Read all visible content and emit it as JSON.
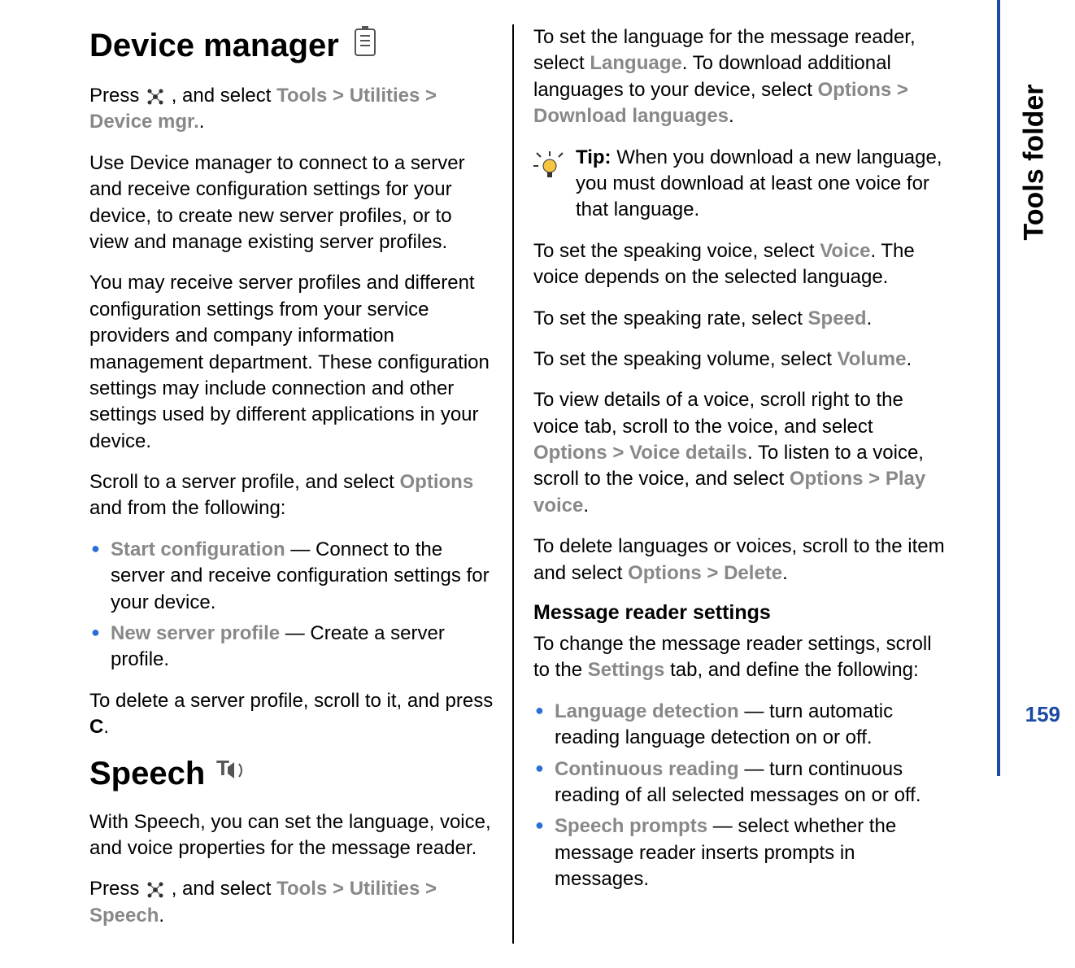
{
  "side_tab": "Tools folder",
  "page_number": "159",
  "left": {
    "h1_device_mgr": "Device manager",
    "dm_press_1": "Press ",
    "dm_press_2": " , and select ",
    "dm_nav_tools": "Tools",
    "dm_nav_util": "Utilities",
    "dm_nav_target": "Device mgr.",
    "dm_period": ".",
    "dm_p1": "Use Device manager to connect to a server and receive configuration settings for your device, to create new server profiles, or to view and manage existing server profiles.",
    "dm_p2": "You may receive server profiles and different configuration settings from your service providers and company information management department. These configuration settings may include connection and other settings used by different applications in your device.",
    "dm_p3a": "Scroll to a server profile, and select ",
    "dm_p3_options": "Options",
    "dm_p3b": " and from the following:",
    "dm_li1_term": "Start configuration",
    "dm_li1_rest": "  — Connect to the server and receive configuration settings for your device.",
    "dm_li2_term": "New server profile",
    "dm_li2_rest": "  — Create a server profile.",
    "dm_p4a": "To delete a server profile, scroll to it, and press ",
    "dm_p4_c": "C",
    "dm_p4b": ".",
    "h1_speech": "Speech",
    "sp_p1": "With Speech, you can set the language, voice, and voice properties for the message reader.",
    "sp_press_1": "Press ",
    "sp_press_2": " , and select ",
    "sp_nav_tools": "Tools",
    "sp_nav_util": "Utilities",
    "sp_nav_target": "Speech",
    "sp_period": "."
  },
  "right": {
    "p1a": "To set the language for the message reader, select ",
    "p1_lang": "Language",
    "p1b": ". To download additional languages to your device, select ",
    "p1_opt": "Options",
    "p1_dl": "Download languages",
    "p1c": ".",
    "tip_label": "Tip:",
    "tip_text": " When you download a new language, you must download at least one voice for that language.",
    "p2a": "To set the speaking voice, select ",
    "p2_voice": "Voice",
    "p2b": ". The voice depends on the selected language.",
    "p3a": "To set the speaking rate, select ",
    "p3_speed": "Speed",
    "p3b": ".",
    "p4a": "To set the speaking volume, select ",
    "p4_vol": "Volume",
    "p4b": ".",
    "p5a": "To view details of a voice, scroll right to the voice tab, scroll to the voice, and select ",
    "p5_opt1": "Options",
    "p5_vd": "Voice details",
    "p5b": ". To listen to a voice, scroll to the voice, and select ",
    "p5_opt2": "Options",
    "p5_pv": "Play voice",
    "p5c": ".",
    "p6a": "To delete languages or voices, scroll to the item and select ",
    "p6_opt": "Options",
    "p6_del": "Delete",
    "p6b": ".",
    "h2_mrs": "Message reader settings",
    "p7a": "To change the message reader settings, scroll to the ",
    "p7_settings": "Settings",
    "p7b": " tab, and define the following:",
    "li1_term": "Language detection",
    "li1_rest": "  — turn automatic reading language detection on or off.",
    "li2_term": "Continuous reading",
    "li2_rest": "  — turn continuous reading of all selected messages on or off.",
    "li3_term": "Speech prompts",
    "li3_rest": "  — select whether the message reader inserts prompts in messages."
  },
  "gt": ">"
}
